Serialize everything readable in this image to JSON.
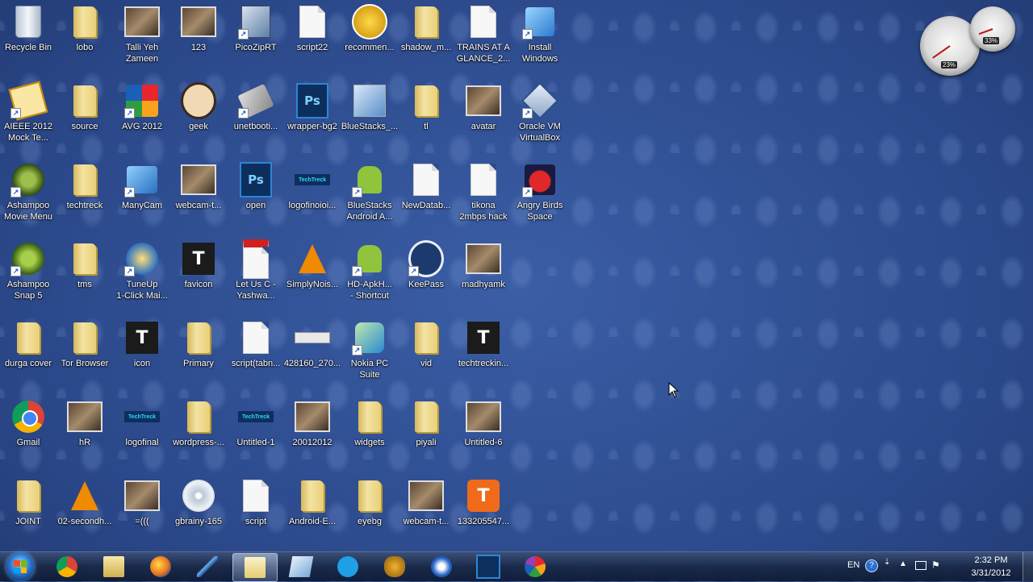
{
  "desktop": {
    "icons": [
      {
        "label": "Recycle Bin",
        "icon": "recycle-bin-icon",
        "shortcut": false
      },
      {
        "label": "lobo",
        "icon": "folder-icon",
        "shortcut": false
      },
      {
        "label": "Talli Yeh\nZameen",
        "icon": "photo-icon",
        "shortcut": false
      },
      {
        "label": "123",
        "icon": "photo-icon",
        "shortcut": false
      },
      {
        "label": "PicoZipRT",
        "icon": "picozip-icon",
        "shortcut": true
      },
      {
        "label": "script22",
        "icon": "document-icon",
        "shortcut": false
      },
      {
        "label": "recommen...",
        "icon": "award-icon",
        "shortcut": false
      },
      {
        "label": "shadow_m...",
        "icon": "folder-icon",
        "shortcut": false
      },
      {
        "label": "TRAINS AT A\nGLANCE_2...",
        "icon": "document-icon",
        "shortcut": false
      },
      {
        "label": "Install\nWindows",
        "icon": "windows-install-icon",
        "shortcut": true
      },
      {
        "label": "AIEEE 2012\nMock Te...",
        "icon": "exam-icon",
        "shortcut": true
      },
      {
        "label": "source",
        "icon": "folder-icon",
        "shortcut": false
      },
      {
        "label": "AVG 2012",
        "icon": "avg-icon",
        "shortcut": true
      },
      {
        "label": "geek",
        "icon": "geek-avatar-icon",
        "shortcut": false
      },
      {
        "label": "unetbooti...",
        "icon": "unetbootin-icon",
        "shortcut": true
      },
      {
        "label": "wrapper-bg2",
        "icon": "photoshop-file-icon",
        "shortcut": false
      },
      {
        "label": "BlueStacks_...",
        "icon": "bluestacks-setup-icon",
        "shortcut": false
      },
      {
        "label": "tl",
        "icon": "folder-icon",
        "shortcut": false
      },
      {
        "label": "avatar",
        "icon": "photo-icon",
        "shortcut": false
      },
      {
        "label": "Oracle VM\nVirtualBox",
        "icon": "virtualbox-icon",
        "shortcut": true
      },
      {
        "label": "Ashampoo\nMovie Menu",
        "icon": "ashampoo-movie-icon",
        "shortcut": true
      },
      {
        "label": "techtreck",
        "icon": "folder-icon",
        "shortcut": false
      },
      {
        "label": "ManyCam",
        "icon": "manycam-icon",
        "shortcut": true
      },
      {
        "label": "webcam-t...",
        "icon": "photo-icon",
        "shortcut": false
      },
      {
        "label": "open",
        "icon": "photoshop-file-icon",
        "shortcut": false
      },
      {
        "label": "logofinoioi...",
        "icon": "logo-strip-icon",
        "shortcut": false
      },
      {
        "label": "BlueStacks\nAndroid A...",
        "icon": "android-icon",
        "shortcut": true
      },
      {
        "label": "NewDatab...",
        "icon": "document-icon",
        "shortcut": false
      },
      {
        "label": "tikona\n2mbps hack",
        "icon": "document-icon",
        "shortcut": false
      },
      {
        "label": "Angry Birds\nSpace",
        "icon": "angry-birds-icon",
        "shortcut": true
      },
      {
        "label": "Ashampoo\nSnap 5",
        "icon": "ashampoo-snap-icon",
        "shortcut": true
      },
      {
        "label": "tms",
        "icon": "folder-icon",
        "shortcut": false
      },
      {
        "label": "TuneUp\n1-Click Mai...",
        "icon": "tuneup-icon",
        "shortcut": true
      },
      {
        "label": "favicon",
        "icon": "techtreck-logo-icon",
        "shortcut": false
      },
      {
        "label": "Let Us C -\nYashwa...",
        "icon": "pdf-icon",
        "shortcut": false
      },
      {
        "label": "SimplyNois...",
        "icon": "vlc-icon",
        "shortcut": false
      },
      {
        "label": "HD-ApkH...\n- Shortcut",
        "icon": "android-icon",
        "shortcut": true
      },
      {
        "label": "KeePass",
        "icon": "keepass-icon",
        "shortcut": true
      },
      {
        "label": "madhyamk",
        "icon": "photo-icon",
        "shortcut": false
      },
      {
        "label": "durga cover",
        "icon": "folder-icon",
        "shortcut": false
      },
      {
        "label": "Tor Browser",
        "icon": "folder-icon",
        "shortcut": false
      },
      {
        "label": "icon",
        "icon": "techtreck-logo-icon",
        "shortcut": false
      },
      {
        "label": "Primary",
        "icon": "folder-icon",
        "shortcut": false
      },
      {
        "label": "script(tabn...",
        "icon": "document-icon",
        "shortcut": false
      },
      {
        "label": "428160_270...",
        "icon": "thin-image-icon",
        "shortcut": false
      },
      {
        "label": "Nokia PC\nSuite",
        "icon": "nokia-suite-icon",
        "shortcut": true
      },
      {
        "label": "vid",
        "icon": "folder-icon",
        "shortcut": false
      },
      {
        "label": "techtreckin...",
        "icon": "techtreck-logo-icon",
        "shortcut": false
      },
      {
        "label": "Gmail",
        "icon": "chrome-icon",
        "shortcut": false
      },
      {
        "label": "hR",
        "icon": "photo-icon",
        "shortcut": false
      },
      {
        "label": "logofinal",
        "icon": "logo-strip-icon",
        "shortcut": false
      },
      {
        "label": "wordpress-...",
        "icon": "folder-icon",
        "shortcut": false
      },
      {
        "label": "Untitled-1",
        "icon": "logo-strip-icon",
        "shortcut": false
      },
      {
        "label": "20012012",
        "icon": "photo-icon",
        "shortcut": false
      },
      {
        "label": "widgets",
        "icon": "folder-icon",
        "shortcut": false
      },
      {
        "label": "piyali",
        "icon": "folder-icon",
        "shortcut": false
      },
      {
        "label": "Untitled-6",
        "icon": "photo-icon",
        "shortcut": false
      },
      {
        "label": "JOINT",
        "icon": "folder-icon",
        "shortcut": false
      },
      {
        "label": "02-secondh...",
        "icon": "vlc-icon",
        "shortcut": false
      },
      {
        "label": "=(((",
        "icon": "photo-icon",
        "shortcut": false
      },
      {
        "label": "gbrainy-165",
        "icon": "installer-disc-icon",
        "shortcut": false
      },
      {
        "label": "script",
        "icon": "document-icon",
        "shortcut": false
      },
      {
        "label": "Android-E...",
        "icon": "folder-icon",
        "shortcut": false
      },
      {
        "label": "eyebg",
        "icon": "folder-icon",
        "shortcut": false
      },
      {
        "label": "webcam-t...",
        "icon": "photo-icon",
        "shortcut": false
      },
      {
        "label": "133205547...",
        "icon": "techtreck-orange-icon",
        "shortcut": false
      }
    ]
  },
  "gadget": {
    "cpu_label": "23%",
    "mem_label": "33%"
  },
  "taskbar": {
    "items": [
      {
        "name": "chrome-icon"
      },
      {
        "name": "file-explorer-icon"
      },
      {
        "name": "firefox-icon"
      },
      {
        "name": "pen-tool-icon"
      },
      {
        "name": "folder-window-icon",
        "active": true
      },
      {
        "name": "blue-app-icon"
      },
      {
        "name": "skype-icon"
      },
      {
        "name": "pineapple-icon"
      },
      {
        "name": "thunderbolt-icon"
      },
      {
        "name": "photoshop-icon"
      },
      {
        "name": "picasa-icon"
      }
    ],
    "tray": {
      "language": "EN",
      "time": "2:32 PM",
      "date": "3/31/2012"
    }
  },
  "colors": {
    "wallpaper": "#2c4a8c",
    "taskbar": "#1a2a4a",
    "folder": "#e9cf78"
  }
}
